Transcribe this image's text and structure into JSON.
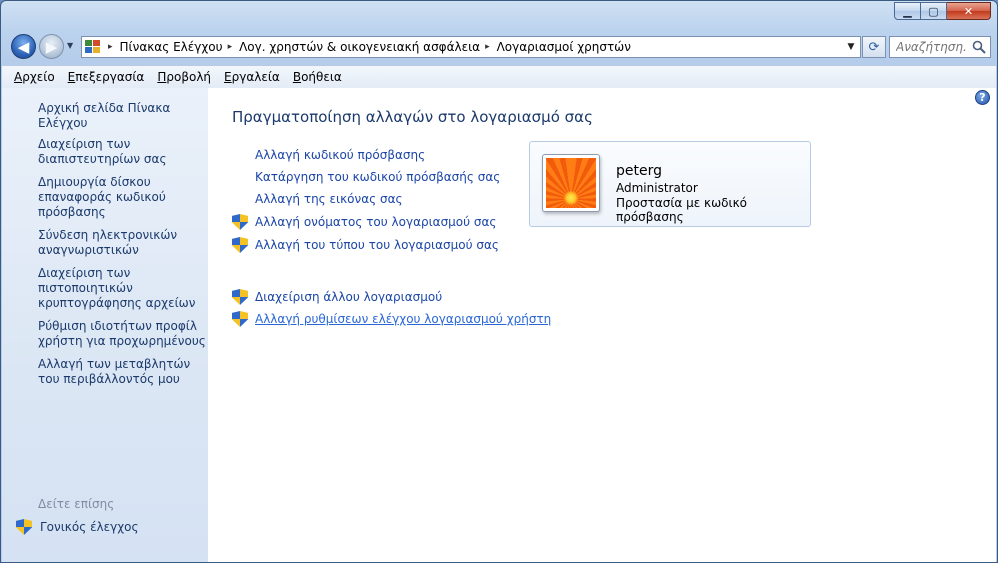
{
  "window": {
    "caption_buttons": {
      "minimize": "▁",
      "maximize": "▢",
      "close": "✕"
    }
  },
  "nav": {
    "back": "◀",
    "forward": "▶",
    "recent": "▼"
  },
  "address_bar": {
    "breadcrumbs": [
      "Πίνακας Ελέγχου",
      "Λογ. χρηστών & οικογενειακή ασφάλεια",
      "Λογαριασμοί χρηστών"
    ],
    "separator": "▸",
    "dropdown": "▼",
    "refresh": "⟳"
  },
  "search": {
    "placeholder": "Αναζήτηση..."
  },
  "menubar": [
    {
      "accel": "Α",
      "rest": "ρχείο"
    },
    {
      "accel": "Ε",
      "rest": "πεξεργασία"
    },
    {
      "accel": "Π",
      "rest": "ροβολή"
    },
    {
      "accel": "Ε",
      "rest": "ργαλεία"
    },
    {
      "accel": "Β",
      "rest": "οήθεια"
    }
  ],
  "sidebar": {
    "links": [
      "Αρχική σελίδα Πίνακα Ελέγχου",
      "Διαχείριση των διαπιστευτηρίων σας",
      "Δημιουργία δίσκου επαναφοράς κωδικού πρόσβασης",
      "Σύνδεση ηλεκτρονικών αναγνωριστικών",
      "Διαχείριση των πιστοποιητικών κρυπτογράφησης αρχείων",
      "Ρύθμιση ιδιοτήτων προφίλ χρήστη για προχωρημένους",
      "Αλλαγή των μεταβλητών του περιβάλλοντός μου"
    ],
    "see_also": "Δείτε επίσης",
    "parental_controls": "Γονικός έλεγχος"
  },
  "main": {
    "title": "Πραγματοποίηση αλλαγών στο λογαριασμό σας",
    "tasks": [
      "Αλλαγή κωδικού πρόσβασης",
      "Κατάργηση του κωδικού πρόσβασής σας",
      "Αλλαγή της εικόνας σας",
      "Αλλαγή ονόματος του λογαριασμού σας",
      "Αλλαγή του τύπου του λογαριασμού σας"
    ],
    "other_tasks": [
      "Διαχείριση άλλου λογαριασμού",
      "Αλλαγή ρυθμίσεων ελέγχου λογαριασμού χρήστη"
    ],
    "help": "?"
  },
  "account": {
    "name": "peterg",
    "role": "Administrator",
    "protection": "Προστασία με κωδικό πρόσβασης"
  }
}
